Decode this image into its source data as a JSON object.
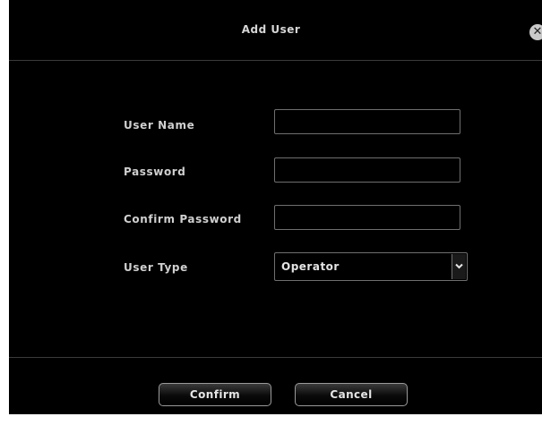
{
  "dialog": {
    "title": "Add User",
    "close_icon": "close-icon"
  },
  "form": {
    "user_name": {
      "label": "User Name",
      "value": ""
    },
    "password": {
      "label": "Password",
      "value": ""
    },
    "confirm_password": {
      "label": "Confirm Password",
      "value": ""
    },
    "user_type": {
      "label": "User Type",
      "selected": "Operator",
      "arrow_icon": "chevron-down-icon"
    }
  },
  "buttons": {
    "confirm": "Confirm",
    "cancel": "Cancel"
  }
}
